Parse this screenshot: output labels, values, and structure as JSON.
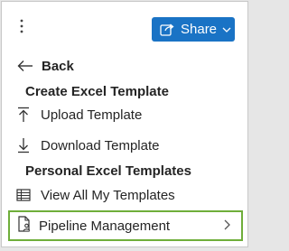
{
  "toolbar": {
    "more_icon": "more-vertical-icon",
    "share_label": "Share",
    "share_icon": "share-arrow-icon",
    "share_color": "#1a73c5"
  },
  "menu": {
    "back_label": "Back",
    "create_section": "Create Excel Template",
    "upload_label": "Upload Template",
    "download_label": "Download Template",
    "personal_section": "Personal Excel Templates",
    "view_all_label": "View All My Templates",
    "pipeline_label": "Pipeline Management",
    "highlight_color": "#6fae3a"
  }
}
